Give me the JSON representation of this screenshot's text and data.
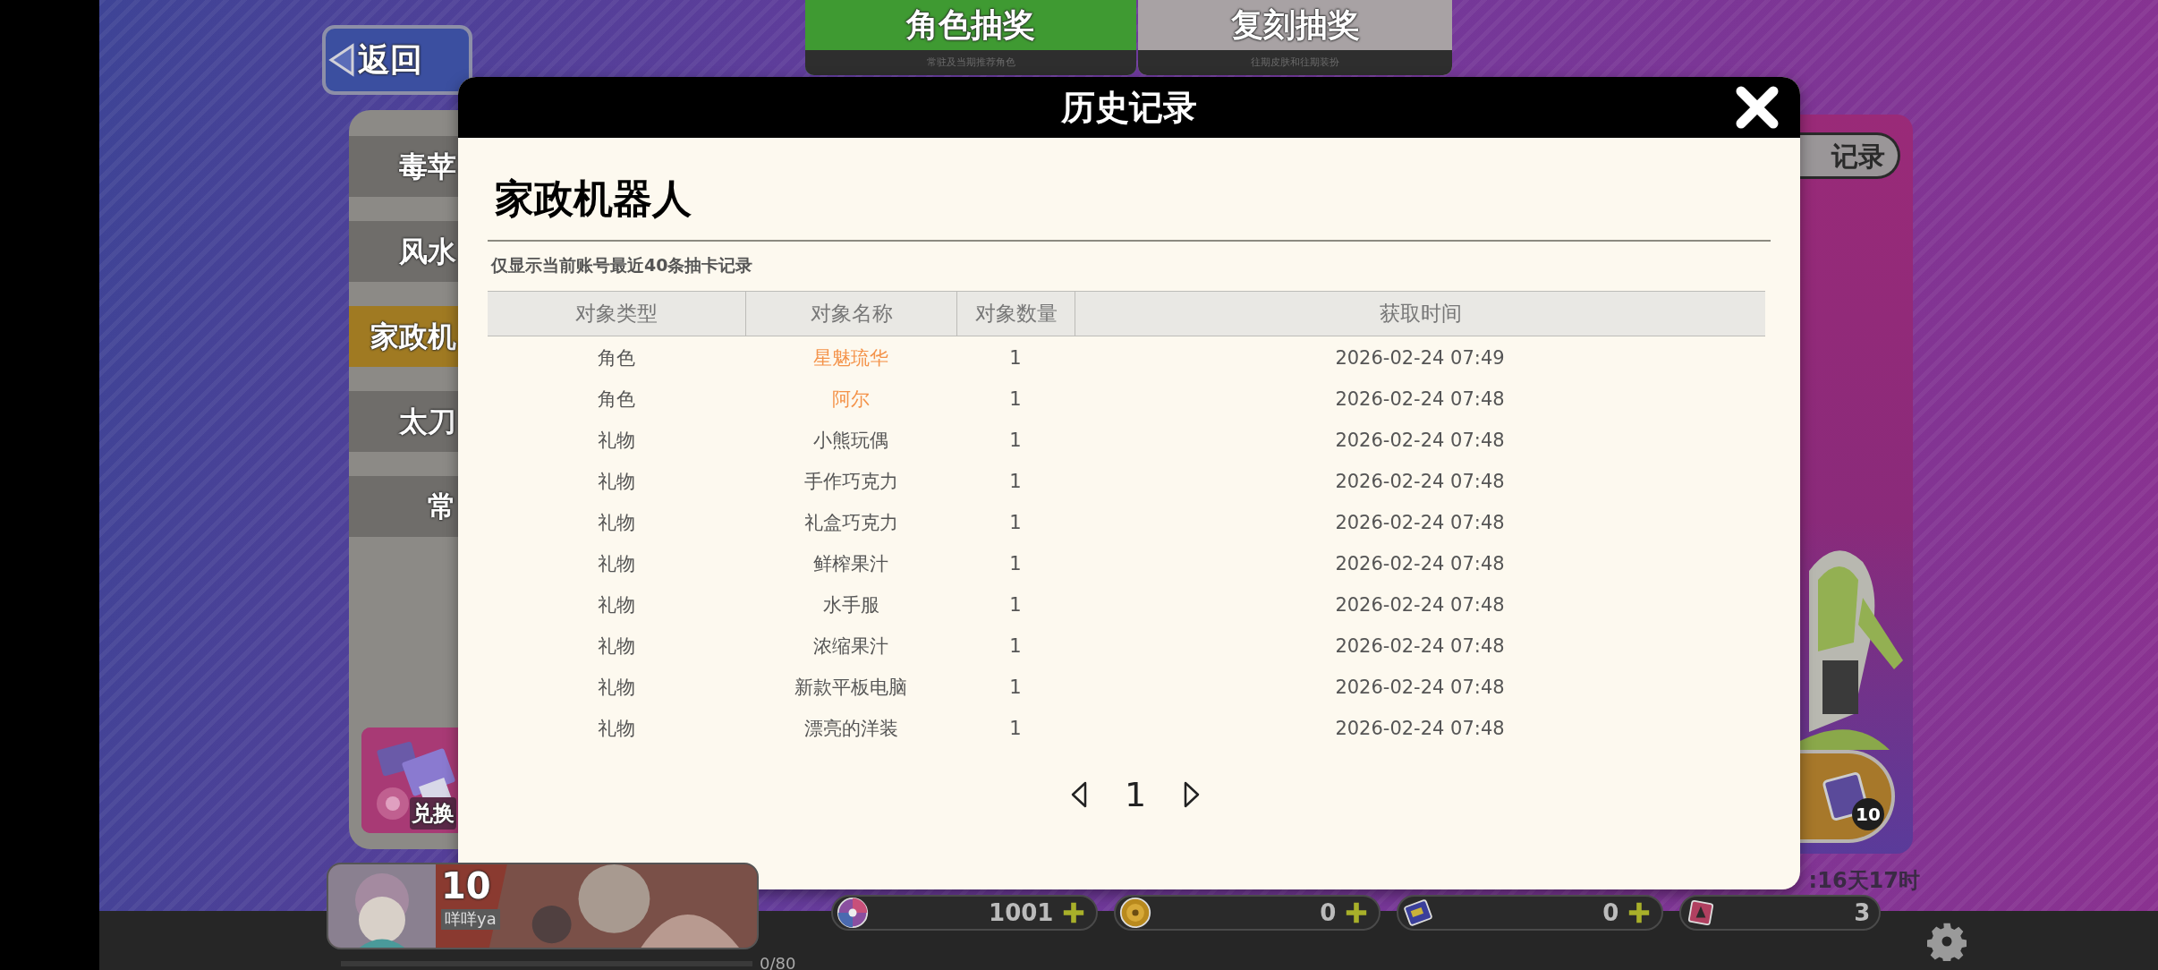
{
  "back_button": "返回",
  "tabs": [
    {
      "label": "角色抽奖",
      "subtitle": "常驻及当期推荐角色",
      "selected": true
    },
    {
      "label": "复刻抽奖",
      "subtitle": "往期皮肤和往期装扮",
      "selected": false
    }
  ],
  "pool_list": [
    {
      "label": "毒苹",
      "selected": false
    },
    {
      "label": "风水",
      "selected": false
    },
    {
      "label": "家政机",
      "selected": true
    },
    {
      "label": "太刀",
      "selected": false
    },
    {
      "label": "常",
      "selected": false
    }
  ],
  "exchange_button": "兑换",
  "record_button": "记录",
  "multi_draw_badge": "10",
  "countdown": ":16天17时",
  "dialog": {
    "title": "历史记录",
    "pool_name": "家政机器人",
    "note": "仅显示当前账号最近40条抽卡记录",
    "columns": [
      "对象类型",
      "对象名称",
      "对象数量",
      "获取时间"
    ],
    "rows": [
      {
        "type": "角色",
        "name": "星魅琉华",
        "count": "1",
        "time": "2026-02-24 07:49",
        "color": "#f4934a"
      },
      {
        "type": "角色",
        "name": "阿尔",
        "count": "1",
        "time": "2026-02-24 07:48",
        "color": "#f4934a"
      },
      {
        "type": "礼物",
        "name": "小熊玩偶",
        "count": "1",
        "time": "2026-02-24 07:48",
        "color": "#555555"
      },
      {
        "type": "礼物",
        "name": "手作巧克力",
        "count": "1",
        "time": "2026-02-24 07:48",
        "color": "#555555"
      },
      {
        "type": "礼物",
        "name": "礼盒巧克力",
        "count": "1",
        "time": "2026-02-24 07:48",
        "color": "#555555"
      },
      {
        "type": "礼物",
        "name": "鲜榨果汁",
        "count": "1",
        "time": "2026-02-24 07:48",
        "color": "#555555"
      },
      {
        "type": "礼物",
        "name": "水手服",
        "count": "1",
        "time": "2026-02-24 07:48",
        "color": "#555555"
      },
      {
        "type": "礼物",
        "name": "浓缩果汁",
        "count": "1",
        "time": "2026-02-24 07:48",
        "color": "#555555"
      },
      {
        "type": "礼物",
        "name": "新款平板电脑",
        "count": "1",
        "time": "2026-02-24 07:48",
        "color": "#555555"
      },
      {
        "type": "礼物",
        "name": "漂亮的洋装",
        "count": "1",
        "time": "2026-02-24 07:48",
        "color": "#555555"
      }
    ],
    "page": "1"
  },
  "player": {
    "level": "10",
    "name": "咩咩ya",
    "exp": "0/80",
    "exp_bar": {
      "level": 0
    }
  },
  "currencies": [
    {
      "kind": "disc",
      "amount": "1001",
      "addable": true
    },
    {
      "kind": "coin",
      "amount": "0",
      "addable": true
    },
    {
      "kind": "card",
      "amount": "0",
      "addable": true
    },
    {
      "kind": "ticket",
      "amount": "3",
      "addable": false
    }
  ]
}
